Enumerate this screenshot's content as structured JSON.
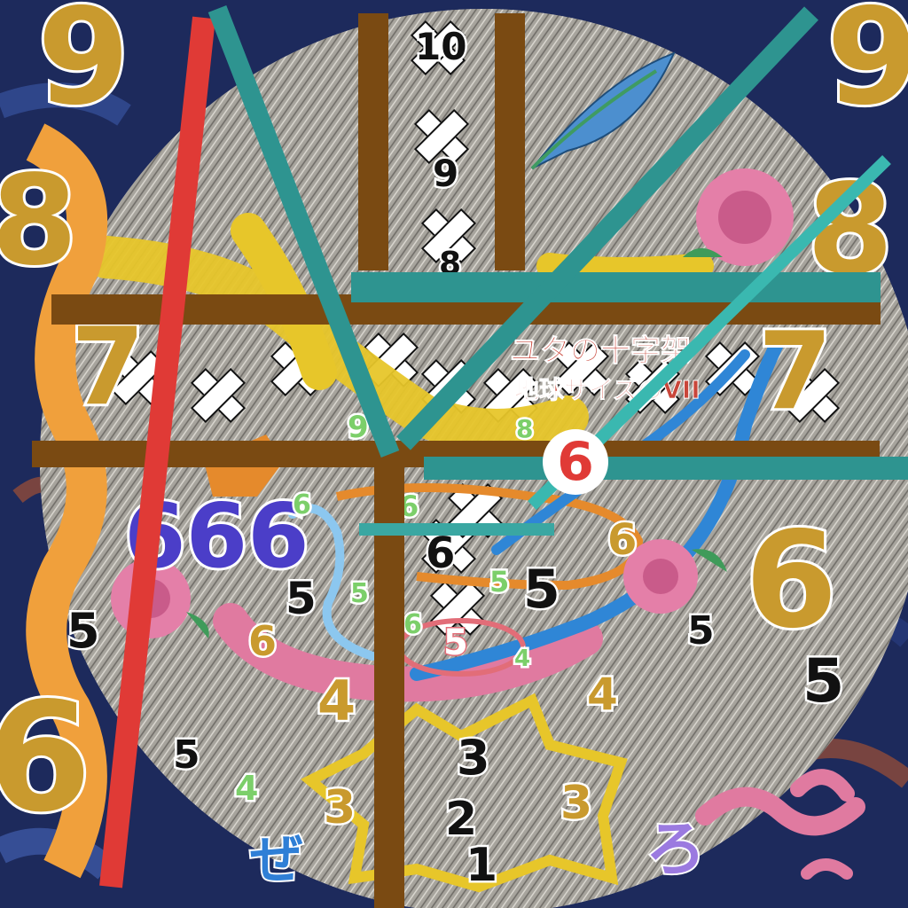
{
  "title_line1": "ユタの十字架",
  "title_line2": "地球サイズのVII",
  "center_badge": "6",
  "numbers": {
    "nine_left": "9",
    "nine_right": "9",
    "eight_left": "8",
    "eight_right": "8",
    "seven_left": "7",
    "seven_right": "7",
    "six_left": "6",
    "six_right": "6",
    "six_triple": "666",
    "five_left": "5",
    "five_right": "5",
    "ten_top": "10",
    "nine_top": "9",
    "eight_top": "8",
    "six_mid_a": "6",
    "six_mid_b": "6",
    "six_mid_c": "6",
    "six_mid_d": "6",
    "six_mid_e": "6",
    "six_inner_orange": "6",
    "five_mid_a": "5",
    "five_mid_b": "5",
    "five_mid_c": "5",
    "five_mid_d": "5",
    "five_mid_e": "5",
    "five_mid_f": "5",
    "four_a": "4",
    "four_b": "4",
    "four_c": "4",
    "four_d": "4",
    "three_a": "3",
    "three_b": "3",
    "three_c": "3",
    "two": "2",
    "one": "1",
    "nine_green": "9",
    "eight_green": "8",
    "five_green": "5"
  },
  "kana_bottom_left": "ぜ",
  "kana_bottom_right": "ろ",
  "colors": {
    "background": "#1d2a5c",
    "brown_bar": "#7a4a12",
    "teal_bar": "#2e9490",
    "red_line": "#e03a36",
    "yellow_paint": "#e7c62a",
    "orange_ribbon": "#f0a03c",
    "pink_swirl": "#e07aa0",
    "blue_arrow": "#2f86d6"
  },
  "icons": [
    "feather-icon",
    "rose-icon",
    "worm-icon",
    "star-burst-icon"
  ]
}
